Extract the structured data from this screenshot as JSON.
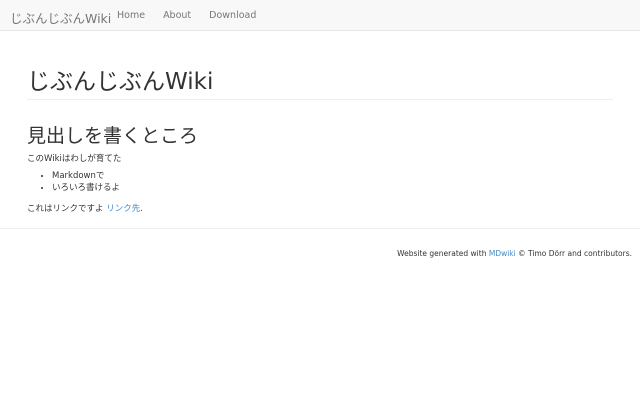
{
  "navbar": {
    "brand": "じぶんじぶんWiki",
    "items": [
      {
        "label": "Home"
      },
      {
        "label": "About"
      },
      {
        "label": "Download"
      }
    ]
  },
  "main": {
    "title": "じぶんじぶんWiki",
    "heading": "見出しを書くところ",
    "intro": "このWikiはわしが育てた",
    "list_items": [
      "Markdownで",
      "いろいろ書けるよ"
    ],
    "link_sentence_prefix": "これはリンクですよ ",
    "link_label": "リンク先",
    "link_sentence_suffix": "."
  },
  "footer": {
    "prefix": "Website generated with ",
    "link_label": "MDwiki",
    "suffix": " © Timo Dörr and contributors."
  },
  "colors": {
    "navbar_bg": "#f8f8f8",
    "link": "#428bca",
    "text": "#333333",
    "nav_text": "#777777"
  }
}
